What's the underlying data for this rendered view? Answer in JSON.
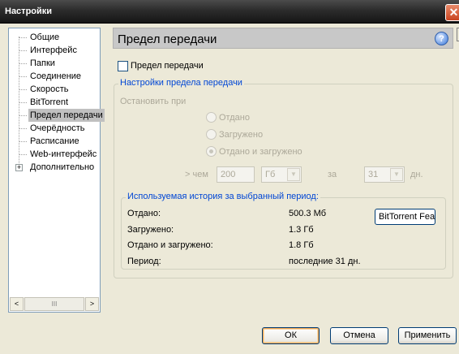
{
  "window": {
    "title": "Настройки",
    "close_glyph": "✕"
  },
  "tree": {
    "items": [
      {
        "label": "Общие"
      },
      {
        "label": "Интерфейс"
      },
      {
        "label": "Папки"
      },
      {
        "label": "Соединение"
      },
      {
        "label": "Скорость"
      },
      {
        "label": "BitTorrent"
      },
      {
        "label": "Предел передачи",
        "selected": true
      },
      {
        "label": "Очерёдность"
      },
      {
        "label": "Расписание"
      },
      {
        "label": "Web-интерфейс"
      },
      {
        "label": "Дополнительно",
        "expandable": true
      }
    ],
    "expander_glyph": "+",
    "scroll_left": "<",
    "scroll_right": ">",
    "scroll_thumb": "III"
  },
  "panel": {
    "header": "Предел передачи",
    "help_glyph": "?",
    "limit_checkbox_label": "Предел передачи",
    "limit_enabled": false,
    "settings_group": {
      "legend": "Настройки предела передачи",
      "stop_when": "Остановить при",
      "radios": [
        {
          "label": "Отдано",
          "checked": false
        },
        {
          "label": "Загружено",
          "checked": false
        },
        {
          "label": "Отдано и загружено",
          "checked": true
        }
      ],
      "more_than": "> чем",
      "amount_value": "200",
      "unit_value": "Гб",
      "for_label": "за",
      "period_value": "31",
      "days_label": "дн."
    },
    "history_group": {
      "legend": "Используемая история за выбранный период:",
      "rows": [
        {
          "label": "Отдано:",
          "value": "500.3 Мб"
        },
        {
          "label": "Загружено:",
          "value": "1.3 Гб"
        },
        {
          "label": "Отдано и загружено:",
          "value": "1.8 Гб"
        },
        {
          "label": "Период:",
          "value": "последние 31 дн."
        }
      ],
      "bittorrent_button": "BitTorrent Fea"
    }
  },
  "footer": {
    "ok": "ОК",
    "cancel": "Отмена",
    "apply": "Применить"
  },
  "colors": {
    "legend": "#0046d5",
    "disabled": "#aca899",
    "background": "#ece9d8"
  }
}
